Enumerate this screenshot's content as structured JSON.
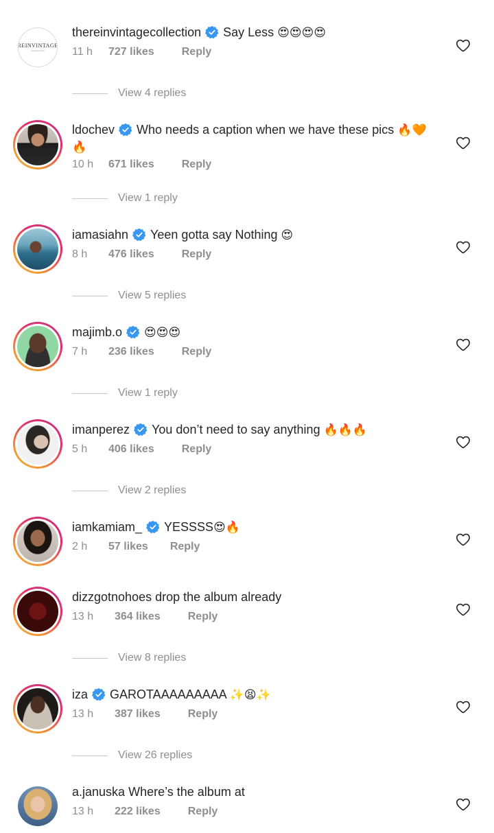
{
  "colors": {
    "text": "#262626",
    "secondary": "#8e8e8e",
    "verified": "#3897f0",
    "ring_start": "#f7b54a",
    "ring_end": "#c13584"
  },
  "icons": {
    "verified": "verified-badge-icon",
    "like": "heart-outline-icon"
  },
  "comments": [
    {
      "username": "thereinvintagecollection",
      "verified": true,
      "text": "Say Less",
      "emoji": "😍😍😍😍",
      "time": "11 h",
      "likes": "727 likes",
      "reply": "Reply",
      "view_replies": "View 4 replies",
      "avatar_logo": "REINVINTAGE",
      "avatar_logo_sub": "COLLECTION"
    },
    {
      "username": "ldochev",
      "verified": true,
      "text": "Who needs a caption when we have these pics",
      "emoji": "🔥🧡",
      "emoji2": "🔥",
      "time": "10 h",
      "likes": "671 likes",
      "reply": "Reply",
      "view_replies": "View 1 reply"
    },
    {
      "username": "iamasiahn",
      "verified": true,
      "text": "Yeen gotta say Nothing",
      "emoji": "😍",
      "time": "8 h",
      "likes": "476 likes",
      "reply": "Reply",
      "view_replies": "View 5 replies"
    },
    {
      "username": "majimb.o",
      "verified": true,
      "text": "",
      "emoji": "😍😍😍",
      "time": "7 h",
      "likes": "236 likes",
      "reply": "Reply",
      "view_replies": "View 1 reply"
    },
    {
      "username": "imanperez",
      "verified": true,
      "text": "You don’t need to say anything",
      "emoji": "🔥🔥🔥",
      "time": "5 h",
      "likes": "406 likes",
      "reply": "Reply",
      "view_replies": "View 2 replies"
    },
    {
      "username": "iamkamiam_",
      "verified": true,
      "text": "YESSSS",
      "emoji": "😍🔥",
      "time": "2 h",
      "likes": "57 likes",
      "reply": "Reply"
    },
    {
      "username": "dizzgotnohoes",
      "verified": false,
      "text": "drop the album already",
      "emoji": "",
      "time": "13 h",
      "likes": "364 likes",
      "reply": "Reply",
      "view_replies": "View 8 replies"
    },
    {
      "username": "iza",
      "verified": true,
      "text": "GAROTAAAAAAAAA",
      "emoji": "✨😫✨",
      "time": "13 h",
      "likes": "387 likes",
      "reply": "Reply",
      "view_replies": "View 26 replies"
    },
    {
      "username": "a.januska",
      "verified": false,
      "text": "Where’s the album at",
      "emoji": "",
      "time": "13 h",
      "likes": "222 likes",
      "reply": "Reply"
    }
  ]
}
